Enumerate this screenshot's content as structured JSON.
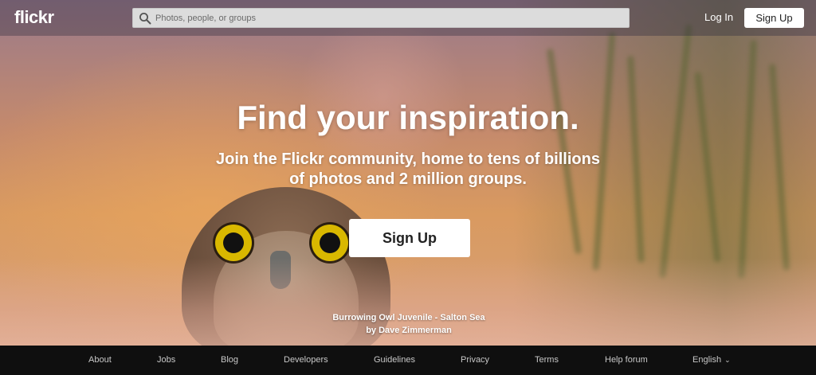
{
  "brand": {
    "logo": "flickr"
  },
  "search": {
    "placeholder": "Photos, people, or groups",
    "value": ""
  },
  "nav": {
    "login": "Log In",
    "signup": "Sign Up"
  },
  "hero": {
    "headline": "Find your inspiration.",
    "subline_1": "Join the Flickr community, home to tens of billions",
    "subline_2": "of photos and 2 million groups.",
    "cta": "Sign Up",
    "credit_title": "Burrowing Owl Juvenile - Salton Sea",
    "credit_author": "by Dave Zimmerman"
  },
  "footer": {
    "links": [
      "About",
      "Jobs",
      "Blog",
      "Developers",
      "Guidelines",
      "Privacy",
      "Terms",
      "Help forum"
    ],
    "language": "English"
  },
  "icons": {
    "search": "search-icon",
    "language_dropdown": "chevron-down-icon"
  }
}
